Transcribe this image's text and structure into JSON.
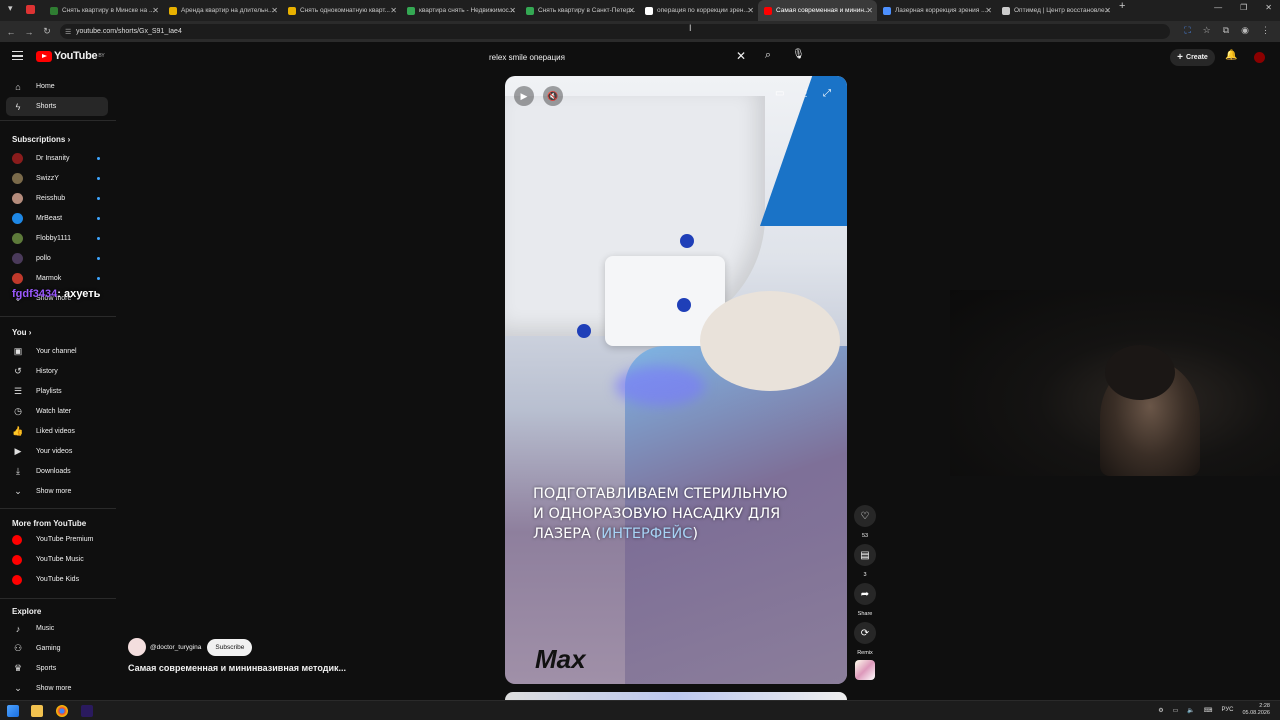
{
  "browser": {
    "tabs": [
      {
        "title": "Снять квартиру в Минске на ...",
        "fav": "#2f7d32"
      },
      {
        "title": "Аренда квартир на длительн...",
        "fav": "#e8b100"
      },
      {
        "title": "Снять однокомнатную кварт...",
        "fav": "#e8b100"
      },
      {
        "title": "квартира снять - Недвижимос...",
        "fav": "#34a853"
      },
      {
        "title": "Снять квартиру в Санкт-Петер...",
        "fav": "#34a853"
      },
      {
        "title": "операция по коррекции зрен...",
        "fav": "#ffffff"
      },
      {
        "title": "Самая современная и минин...",
        "fav": "#ff0000"
      },
      {
        "title": "Лазерная коррекция зрения ...",
        "fav": "#4d90fe"
      },
      {
        "title": "Оптимед | Центр восстановле...",
        "fav": "#cccccc"
      }
    ],
    "active_tab": 6,
    "url": "youtube.com/shorts/Gx_S91_Iae4"
  },
  "header": {
    "logo": "YouTube",
    "region": "BY",
    "search_value": "relex smile операция",
    "create_label": "Create"
  },
  "sidebar": {
    "main": [
      {
        "label": "Home",
        "icon": "⌂"
      },
      {
        "label": "Shorts",
        "icon": "ϟ"
      }
    ],
    "subs_header": "Subscriptions",
    "subs": [
      {
        "label": "Dr Insanity",
        "color": "#8a1c1c"
      },
      {
        "label": "SwizzY",
        "color": "#7a6a4a"
      },
      {
        "label": "Reisshub",
        "color": "#b58c7c"
      },
      {
        "label": "MrBeast",
        "color": "#1e88e5"
      },
      {
        "label": "Flobby1111",
        "color": "#5d7a3a"
      },
      {
        "label": "pollo",
        "color": "#4a3a5a"
      },
      {
        "label": "Marmok",
        "color": "#c0392b"
      }
    ],
    "subs_more": "Show more",
    "you_header": "You",
    "you": [
      {
        "label": "Your channel",
        "icon": "▣"
      },
      {
        "label": "History",
        "icon": "↺"
      },
      {
        "label": "Playlists",
        "icon": "☰"
      },
      {
        "label": "Watch later",
        "icon": "◷"
      },
      {
        "label": "Liked videos",
        "icon": "👍"
      },
      {
        "label": "Your videos",
        "icon": "▶"
      },
      {
        "label": "Downloads",
        "icon": "⤓"
      },
      {
        "label": "Show more",
        "icon": "⌄"
      }
    ],
    "more_header": "More from YouTube",
    "more": [
      {
        "label": "YouTube Premium",
        "color": "#ff0000"
      },
      {
        "label": "YouTube Music",
        "color": "#ff0000"
      },
      {
        "label": "YouTube Kids",
        "color": "#ff0000"
      }
    ],
    "explore_header": "Explore",
    "explore": [
      {
        "label": "Music",
        "icon": "♪"
      },
      {
        "label": "Gaming",
        "icon": "⚇"
      },
      {
        "label": "Sports",
        "icon": "♛"
      },
      {
        "label": "Show more",
        "icon": "⌄"
      }
    ]
  },
  "chat": {
    "user": "fgdf3434",
    "message": ": ахуеть"
  },
  "short": {
    "subtitle_line1": " ПОДГОТАВЛИВАЕМ СТЕРИЛЬНУЮ",
    "subtitle_line2": "И ОДНОРАЗОВУЮ НАСАДКУ ДЛЯ",
    "subtitle_line3a": "ЛАЗЕРА (",
    "subtitle_line3b": "ИНТЕРФЕЙС",
    "subtitle_line3c": ")",
    "watermark": "Max",
    "channel": "@doctor_turygina",
    "subscribe": "Subscribe",
    "title": "Самая современная и мининвазивная  методик..."
  },
  "actions": {
    "likes": "53",
    "comments": "3",
    "share": "Share",
    "remix": "Remix"
  },
  "taskbar": {
    "lang": "РУС",
    "time": "2:28",
    "date": "05.08.2026"
  }
}
